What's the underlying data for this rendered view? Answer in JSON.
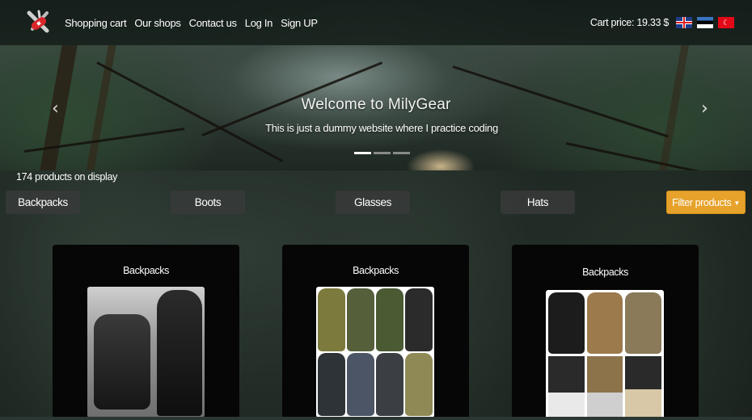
{
  "navbar": {
    "logo_icon": "swiss-knife-icon",
    "links": [
      "Shopping cart",
      "Our shops",
      "Contact us",
      "Log In",
      "Sign UP"
    ],
    "cart_price": "Cart price: 19.33 $",
    "flags": [
      "uk-flag-icon",
      "estonia-flag-icon",
      "turkey-flag-icon"
    ]
  },
  "carousel": {
    "title": "Welcome to MilyGear",
    "subtitle": "This is just a dummy website where I practice coding",
    "prev_icon": "‹",
    "next_icon": "›",
    "slide_count": 3,
    "active_slide": 1
  },
  "products_count": "174 products on display",
  "categories": [
    "Backpacks",
    "Boots",
    "Glasses",
    "Hats"
  ],
  "filter": {
    "label": "Filter products",
    "caret": "▼"
  },
  "products": [
    {
      "title": "Backpacks"
    },
    {
      "title": "Backpacks"
    },
    {
      "title": "Backpacks"
    }
  ],
  "colors": {
    "accent": "#e6a22a",
    "card_bg": "#060606",
    "category_bg": "#373a38"
  }
}
